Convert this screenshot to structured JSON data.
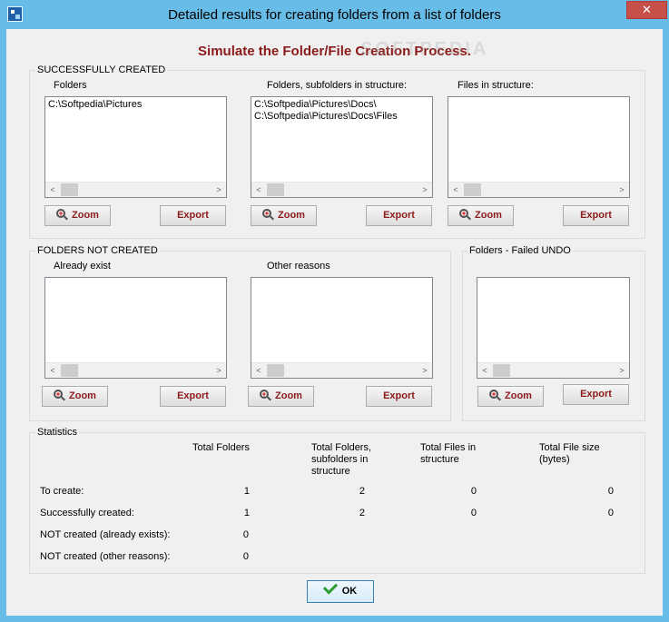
{
  "window": {
    "title": "Detailed results for creating folders from a list of folders",
    "close_glyph": "✕"
  },
  "banner": "Simulate the Folder/File Creation Process.",
  "watermark": "SOFTPEDIA",
  "successfully_created": {
    "title": "SUCCESSFULLY CREATED",
    "folders": {
      "label": "Folders",
      "items": [
        "C:\\Softpedia\\Pictures"
      ]
    },
    "structure": {
      "label": "Folders, subfolders in structure:",
      "items": [
        "C:\\Softpedia\\Pictures\\Docs\\",
        "C:\\Softpedia\\Pictures\\Docs\\Files"
      ]
    },
    "files": {
      "label": "Files in structure:",
      "items": []
    }
  },
  "not_created": {
    "title": "FOLDERS  NOT CREATED",
    "already_exist": {
      "label": "Already exist",
      "items": []
    },
    "other_reasons": {
      "label": "Other reasons",
      "items": []
    }
  },
  "failed_undo": {
    "title": "Folders - Failed UNDO",
    "items": []
  },
  "buttons": {
    "zoom": "Zoom",
    "export": "Export",
    "ok": "OK"
  },
  "scroll": {
    "left": "<",
    "right": ">"
  },
  "statistics": {
    "title": "Statistics",
    "headers": {
      "total_folders": "Total Folders",
      "total_structure_1": "Total Folders,",
      "total_structure_2": "subfolders in",
      "total_structure_3": "structure",
      "total_files_1": "Total Files in",
      "total_files_2": "structure",
      "total_size_1": "Total File size",
      "total_size_2": "(bytes)"
    },
    "rows": [
      {
        "label": "To create:",
        "values": [
          "1",
          "2",
          "0",
          "0"
        ]
      },
      {
        "label": "Successfully created:",
        "values": [
          "1",
          "2",
          "0",
          "0"
        ]
      },
      {
        "label": "NOT created (already exists):",
        "values": [
          "0"
        ]
      },
      {
        "label": "NOT created (other reasons):",
        "values": [
          "0"
        ]
      }
    ]
  },
  "colors": {
    "accent": "#8b1a1a",
    "titlebar": "#67bde8",
    "close": "#c7504b"
  },
  "icons": {
    "zoom": "magnifier-plus-icon",
    "ok": "checkmark-icon",
    "close": "close-icon"
  }
}
